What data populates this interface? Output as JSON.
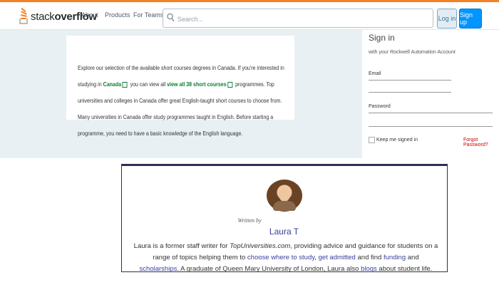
{
  "header": {
    "logo_light": "stack",
    "logo_bold": "overflow",
    "nav": [
      "About",
      "Products",
      "For Teams"
    ],
    "search_placeholder": "Search...",
    "login_label": "Log in",
    "signup_label": "Sign up"
  },
  "article": {
    "p1": "Explore our selection of the available short courses degrees in Canada. If you're interested in studying in",
    "link_country": "Canada",
    "p2": "you can view all",
    "link_courses": "view all 38 short courses",
    "p3": "programmes. Top universities and colleges in Canada offer great English-taught short courses to choose from. Many universities in Canada offer study programmes taught in English. Before starting a programme, you need to have a basic knowledge of the English language."
  },
  "signin": {
    "title": "Sign in",
    "subtitle": "with your Rockwell Automation Account",
    "email_label": "Email",
    "password_label": "Password",
    "remember_label": "Keep me signed in",
    "forgot_label": "Forgot Password?"
  },
  "author": {
    "written_by": "Written by",
    "name": "Laura T",
    "bio_1": "Laura is a former staff writer for ",
    "bio_site": "TopUniversities.com",
    "bio_2": ", providing advice and guidance for students on a range of topics helping them to ",
    "link_choose": "choose where to study",
    "bio_3": ", ",
    "link_admitted": "get admitted",
    "bio_4": " and find ",
    "link_funding": "funding",
    "bio_5": " and ",
    "link_scholarships": "scholarships",
    "bio_6": ". A graduate of Queen Mary University of London, Laura also ",
    "link_blogs": "blogs",
    "bio_7": " about student life."
  },
  "colors": {
    "accent": "#f48024",
    "link_green": "#0a7d33",
    "author_link": "#3a3f9a",
    "signup_blue": "#0095ff",
    "forgot_red": "#c00000"
  }
}
